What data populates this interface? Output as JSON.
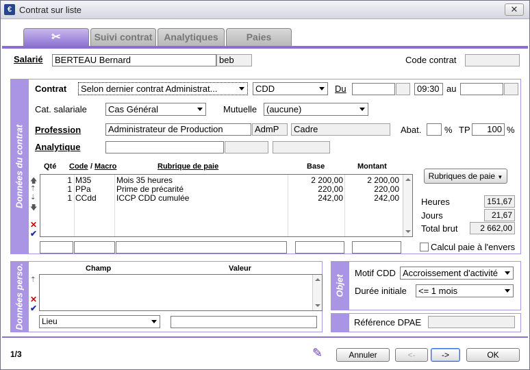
{
  "window": {
    "title": "Contrat sur liste"
  },
  "tabs": [
    {
      "label": ""
    },
    {
      "label": "Suivi contrat"
    },
    {
      "label": "Analytiques"
    },
    {
      "label": "Paies"
    }
  ],
  "salarie": {
    "label": "Salarié",
    "name": "BERTEAU Bernard",
    "code": "beb"
  },
  "code_contrat": {
    "label": "Code contrat",
    "value": ""
  },
  "sections": {
    "donnees_contrat": "Données du contrat",
    "donnees_perso": "Données perso.",
    "objet": "Objet"
  },
  "contrat": {
    "label": "Contrat",
    "type_value": "Selon dernier contrat Administrat...",
    "kind_value": "CDD",
    "du_label": "Du",
    "start_date": "",
    "start_time": "09:30",
    "au_label": "au",
    "end_date": ""
  },
  "cat_salariale": {
    "label": "Cat. salariale",
    "value": "Cas Général"
  },
  "mutuelle": {
    "label": "Mutuelle",
    "value": "(aucune)"
  },
  "profession": {
    "label": "Profession",
    "value": "Administrateur de Production",
    "code": "AdmP",
    "category": "Cadre"
  },
  "abat": {
    "label": "Abat.",
    "value": "",
    "unit": "%"
  },
  "tp": {
    "label": "TP",
    "value": "100",
    "unit": "%"
  },
  "analytique": {
    "label": "Analytique"
  },
  "rubriques_table": {
    "headers": {
      "qte": "Qté",
      "code": "Code",
      "macro": "Macro",
      "sep": "/",
      "rubrique": "Rubrique de paie",
      "base": "Base",
      "montant": "Montant"
    },
    "rows": [
      {
        "qte": "1",
        "code": "M35",
        "rubrique": "Mois 35 heures",
        "base": "2 200,00",
        "montant": "2 200,00"
      },
      {
        "qte": "1",
        "code": "PPa",
        "rubrique": "Prime de précarité",
        "base": "220,00",
        "montant": "220,00"
      },
      {
        "qte": "1",
        "code": "CCdd",
        "rubrique": "ICCP CDD cumulée",
        "base": "242,00",
        "montant": "242,00"
      }
    ]
  },
  "rubriques_button": "Rubriques de paie",
  "totals": {
    "heures_label": "Heures",
    "heures": "151,67",
    "jours_label": "Jours",
    "jours": "21,67",
    "brut_label": "Total brut",
    "brut": "2 662,00"
  },
  "calcul_envers": {
    "label": "Calcul paie à l'envers",
    "checked": false
  },
  "perso_table": {
    "headers": {
      "champ": "Champ",
      "valeur": "Valeur"
    }
  },
  "lieu_select": {
    "value": "Lieu"
  },
  "motif_cdd": {
    "label": "Motif CDD",
    "value": "Accroissement d'activité"
  },
  "duree_initiale": {
    "label": "Durée initiale",
    "value": "<= 1 mois"
  },
  "reference_dpae": {
    "label": "Référence DPAE",
    "value": ""
  },
  "footer": {
    "page": "1/3",
    "annuler": "Annuler",
    "prev": "<-",
    "next": "->",
    "ok": "OK"
  }
}
